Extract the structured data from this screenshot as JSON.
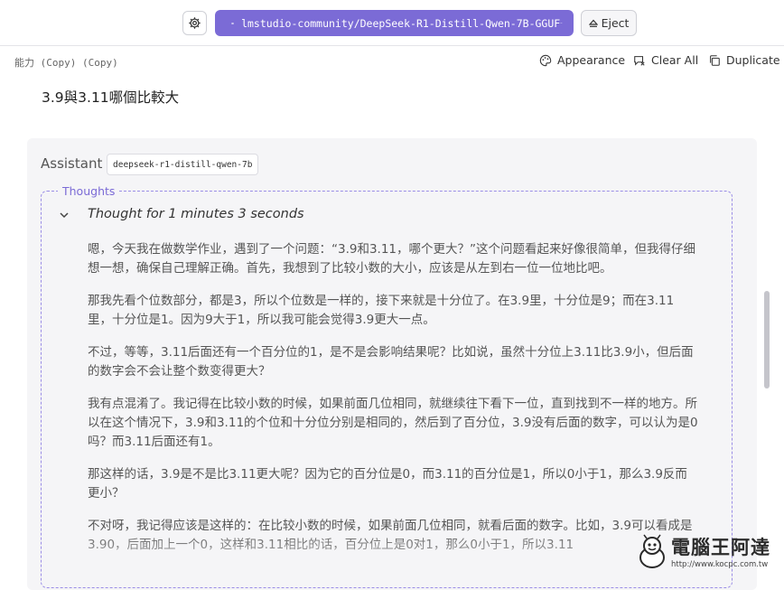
{
  "toolbar": {
    "model_label": "lmstudio-community/DeepSeek-R1-Distill-Qwen-7B-GGUF",
    "eject_label": "Eject"
  },
  "subbar": {
    "chat_name": "能力 (Copy) (Copy)",
    "appearance_label": "Appearance",
    "clear_all_label": "Clear All",
    "duplicate_label": "Duplicate"
  },
  "user_message": "3.9與3.11哪個比較大",
  "assistant": {
    "role_label": "Assistant",
    "model_chip": "deepseek-r1-distill-qwen-7b",
    "thoughts_label": "Thoughts",
    "thought_time": "Thought for 1 minutes 3 seconds",
    "paragraphs": [
      "嗯，今天我在做数学作业，遇到了一个问题：“3.9和3.11，哪个更大？”这个问题看起来好像很简单，但我得仔细想一想，确保自己理解正确。首先，我想到了比较小数的大小，应该是从左到右一位一位地比吧。",
      "那我先看个位数部分，都是3，所以个位数是一样的，接下来就是十分位了。在3.9里，十分位是9；而在3.11里，十分位是1。因为9大于1，所以我可能会觉得3.9更大一点。",
      "不过，等等，3.11后面还有一个百分位的1，是不是会影响结果呢？比如说，虽然十分位上3.11比3.9小，但后面的数字会不会让整个数变得更大？",
      "我有点混淆了。我记得在比较小数的时候，如果前面几位相同，就继续往下看下一位，直到找到不一样的地方。所以在这个情况下，3.9和3.11的个位和十分位分别是相同的，然后到了百分位，3.9没有后面的数字，可以认为是0吗？而3.11后面还有1。",
      "那这样的话，3.9是不是比3.11更大呢？因为它的百分位是0，而3.11的百分位是1，所以0小于1，那么3.9反而更小？",
      "不对呀，我记得应该是这样的：在比较小数的时候，如果前面几位相同，就看后面的数字。比如，3.9可以看成是3.90，后面加上一个0，这样和3.11相比的话，百分位上是0对1，那么0小于1，所以3.11"
    ]
  },
  "watermark": {
    "title": "電腦王阿達",
    "url": "http://www.kocpc.com.tw"
  },
  "colors": {
    "accent": "#7b6bd6",
    "card_bg": "#f5f5f7"
  }
}
